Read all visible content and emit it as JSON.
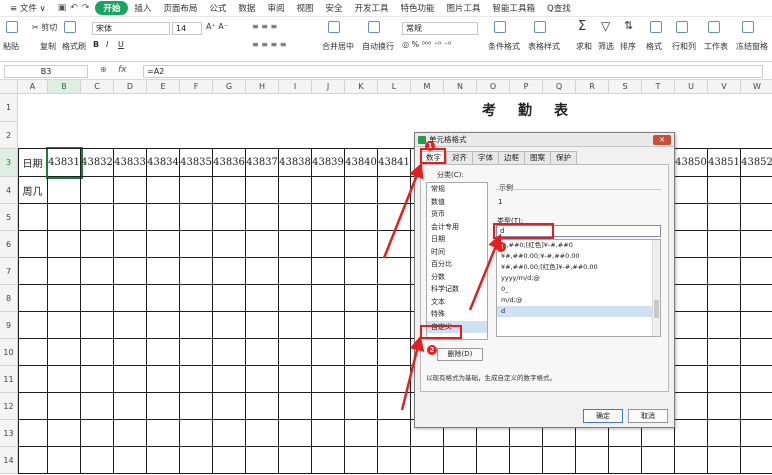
{
  "menubar": {
    "items": [
      "≡ 文件 ∨",
      "插入",
      "页面布局",
      "公式",
      "数据",
      "审阅",
      "视图",
      "安全",
      "开发工具",
      "特色功能",
      "图片工具",
      "智能工具箱",
      "Q查找"
    ],
    "start_label": "开始"
  },
  "ribbon": {
    "paste": "粘贴",
    "cut": "✂ 剪切",
    "copy": "复制",
    "format_painter": "格式刷",
    "font_name": "宋体",
    "font_size": "14",
    "merge": "合并居中",
    "wrap": "自动换行",
    "num_format": "常规",
    "cond_format": "条件格式",
    "table_style": "表格样式",
    "sum": "求和",
    "filter": "筛选",
    "sort": "排序",
    "format": "格式",
    "rowcol": "行和列",
    "sheet": "工作表",
    "freeze": "冻结窗格"
  },
  "formula_bar": {
    "namebox": "B3",
    "fx": "fx",
    "formula": "=A2"
  },
  "columns": [
    "A",
    "B",
    "C",
    "D",
    "E",
    "F",
    "G",
    "H",
    "I",
    "J",
    "K",
    "L",
    "M",
    "N",
    "O",
    "P",
    "Q",
    "R",
    "S",
    "T",
    "U",
    "V",
    "W"
  ],
  "rows": [
    "1",
    "2",
    "3",
    "4",
    "5",
    "6",
    "7",
    "8",
    "9",
    "10",
    "11",
    "12",
    "13",
    "14"
  ],
  "sheet": {
    "title": "考勤表",
    "row3_label": "日期",
    "row4_label": "周几",
    "dates_left": [
      "43831",
      "43832",
      "43833",
      "43834",
      "43835",
      "43836",
      "43837",
      "43838",
      "43839",
      "43840",
      "43841"
    ],
    "dates_right": [
      "43850",
      "43851",
      "43852"
    ]
  },
  "dialog": {
    "title": "单元格格式",
    "tabs": [
      "数字",
      "对齐",
      "字体",
      "边框",
      "图案",
      "保护"
    ],
    "category_label": "分类(C):",
    "categories": [
      "常规",
      "数值",
      "货币",
      "会计专用",
      "日期",
      "时间",
      "百分比",
      "分数",
      "科学记数",
      "文本",
      "特殊",
      "自定义"
    ],
    "sample_label": "示例",
    "sample_value": "1",
    "type_label": "类型(T):",
    "type_value": "d",
    "formats": [
      "#,##0;[红色]¥-#,##0",
      "¥#,##0.00;¥-#,##0.00",
      "¥#,##0.00;[红色]¥-#,##0.00",
      "yyyy/m/d;@",
      "0_",
      "m/d;@",
      "d"
    ],
    "delete_label": "删除(D)",
    "hint": "以现有格式为基础，生成自定义的数字格式。",
    "ok_label": "确定",
    "cancel_label": "取消"
  },
  "annotations": [
    "1",
    "2",
    "3"
  ],
  "colors": {
    "accent": "#19a463",
    "annotation": "#e02020"
  }
}
